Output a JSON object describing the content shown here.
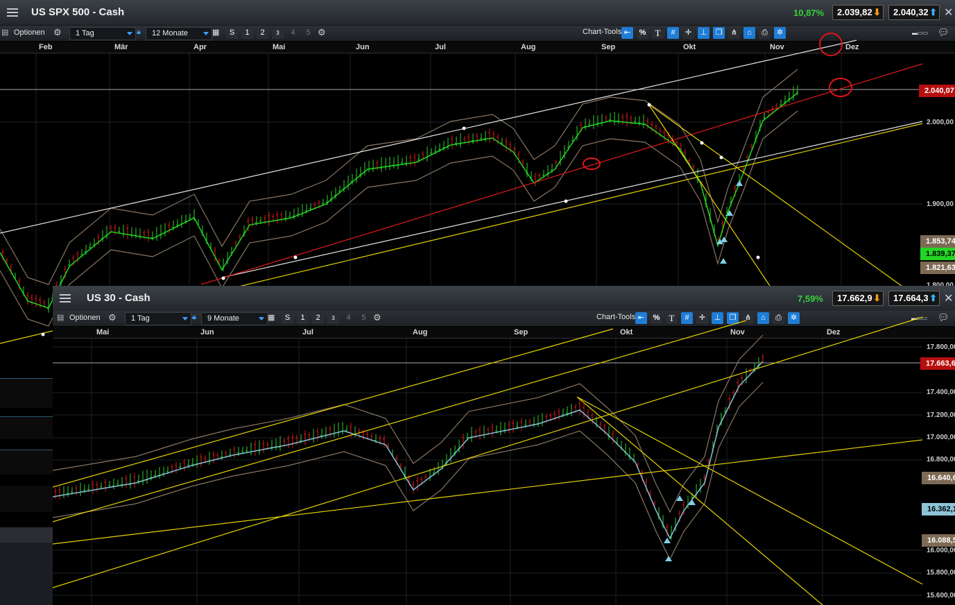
{
  "colors": {
    "up": "#2fd12f",
    "down": "#e01818",
    "accent": "#1f7dd6",
    "pct_up": "#36d13a",
    "price_red": "#c41010"
  },
  "spx": {
    "title": "US SPX 500 - Cash",
    "change_pct": "10,87%",
    "bid": "2.039,82",
    "ask": "2.040,32",
    "toolbar": {
      "options": "Optionen",
      "interval": "1 Tag",
      "range": "12 Monate",
      "chart_tools": "Chart-Tools",
      "btn_s": "S",
      "btn_1": "1",
      "btn_2": "2",
      "btn_3": "3",
      "btn_4": "4",
      "btn_5": "5",
      "pct_btn": "%",
      "text_btn": "T"
    },
    "months": [
      "Feb",
      "Mär",
      "Apr",
      "Mai",
      "Jun",
      "Jul",
      "Aug",
      "Sep",
      "Okt",
      "Nov",
      "Dez"
    ],
    "y_ticks": [
      "2.000,00",
      "1.900,00",
      "1.800,00"
    ],
    "price_tag": "2.040,07",
    "side_tags": [
      "1.853,74",
      "1.839,37",
      "1.821,63"
    ]
  },
  "dow": {
    "title": "US 30 - Cash",
    "change_pct": "7,59%",
    "bid": "17.662,9",
    "ask": "17.664,3",
    "toolbar": {
      "options": "Optionen",
      "interval": "1 Tag",
      "range": "9 Monate",
      "chart_tools": "Chart-Tools",
      "btn_s": "S",
      "btn_1": "1",
      "btn_2": "2",
      "btn_3": "3",
      "btn_4": "4",
      "btn_5": "5",
      "pct_btn": "%",
      "text_btn": "T"
    },
    "months": [
      "Mai",
      "Jun",
      "Jul",
      "Aug",
      "Sep",
      "Okt",
      "Nov",
      "Dez"
    ],
    "y_ticks": [
      "17.800,00",
      "17.400,00",
      "17.200,00",
      "17.000,00",
      "16.800,00",
      "16.000,00",
      "15.800,00",
      "15.600,00"
    ],
    "price_tag": "17.663,6",
    "side_tags": [
      "16.640,6",
      "16.362,1",
      "16.088,5"
    ]
  }
}
